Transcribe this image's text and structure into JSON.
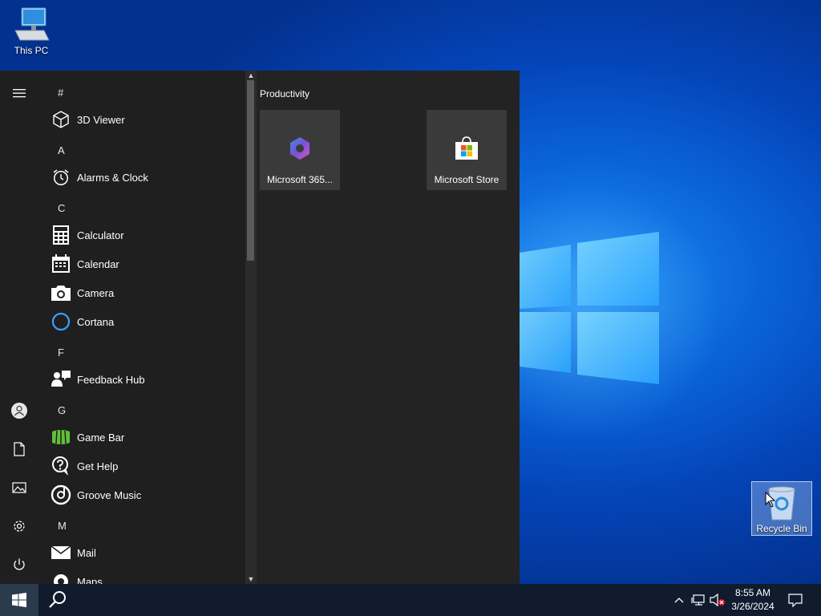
{
  "desktop": {
    "icons": [
      {
        "label": "This PC"
      },
      {
        "label": "Recycle Bin"
      }
    ]
  },
  "start_menu": {
    "app_list": [
      {
        "letter": "#"
      },
      {
        "app": "3D Viewer"
      },
      {
        "letter": "A"
      },
      {
        "app": "Alarms & Clock"
      },
      {
        "letter": "C"
      },
      {
        "app": "Calculator"
      },
      {
        "app": "Calendar"
      },
      {
        "app": "Camera"
      },
      {
        "app": "Cortana"
      },
      {
        "letter": "F"
      },
      {
        "app": "Feedback Hub"
      },
      {
        "letter": "G"
      },
      {
        "app": "Game Bar"
      },
      {
        "app": "Get Help"
      },
      {
        "app": "Groove Music"
      },
      {
        "letter": "M"
      },
      {
        "app": "Mail"
      },
      {
        "app": "Maps"
      }
    ],
    "tiles_group": "Productivity",
    "tiles": [
      {
        "label": "Microsoft 365..."
      },
      {
        "label": "Microsoft Store"
      }
    ],
    "rail_icons": [
      "hamburger-icon",
      "user-icon",
      "documents-icon",
      "pictures-icon",
      "settings-icon",
      "power-icon"
    ]
  },
  "taskbar": {
    "clock_time": "8:55 AM",
    "clock_date": "3/26/2024"
  },
  "colors": {
    "start_bg": "#1f1f1f",
    "tile_bg": "#3a3a3a",
    "taskbar_bg": "#101c2e",
    "accent": "#0a63d8"
  }
}
